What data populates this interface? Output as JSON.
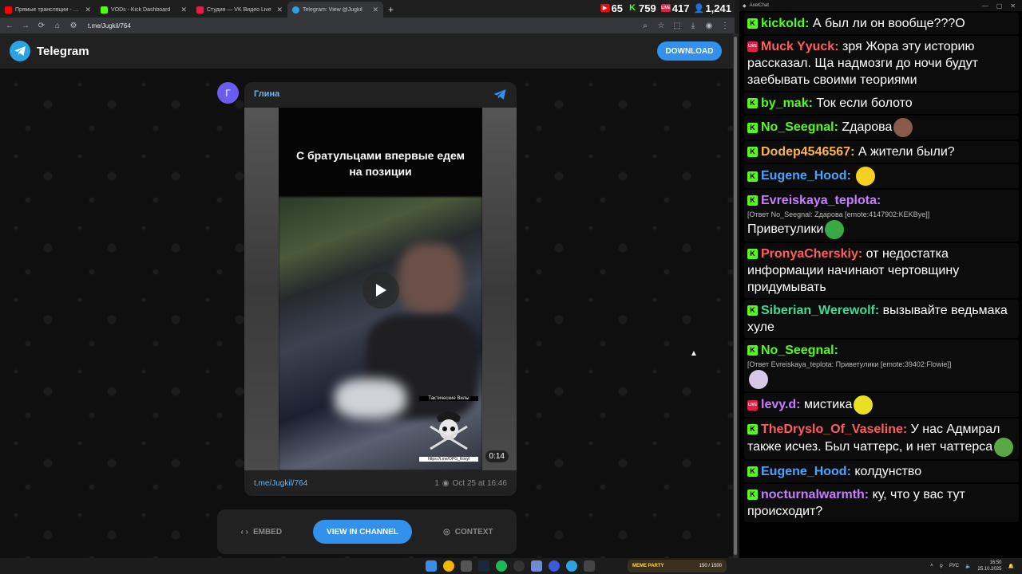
{
  "browser": {
    "tabs": [
      {
        "title": "Прямые трансляции - YouTube",
        "color": "#ff0000",
        "active": false
      },
      {
        "title": "VODs - Kick Dashboard",
        "color": "#53fc18",
        "active": false
      },
      {
        "title": "Студия — VK Видео Live",
        "color": "#e11d48",
        "active": false
      },
      {
        "title": "Telegram: View @Jugkil",
        "color": "#2aa3e0",
        "active": true
      }
    ],
    "new_tab": "+",
    "url": "t.me/Jugkil/764",
    "stats": [
      {
        "platform": "youtube",
        "value": "65",
        "color": "#ff0000"
      },
      {
        "platform": "kick",
        "value": "759",
        "color": "#53fc18"
      },
      {
        "platform": "vk",
        "value": "417",
        "color": "#e11d48"
      },
      {
        "platform": "total",
        "value": "1,241",
        "color": "#4aa3ff"
      }
    ]
  },
  "telegram": {
    "brand": "Telegram",
    "download": "DOWNLOAD",
    "channel_initial": "Г",
    "channel_name": "Глина",
    "video_caption": "С братульцами впервые едем на позиции",
    "watermark_title": "Тактические Вилы",
    "watermark_link": "https://t.me/OPG_Kovyl",
    "duration": "0:14",
    "post_link": "t.me/Jugkil/764",
    "views": "1",
    "date": "Oct 25 at 16:46",
    "actions": {
      "embed": "EMBED",
      "view": "VIEW IN CHANNEL",
      "context": "CONTEXT"
    }
  },
  "chat": {
    "app_title": "AxelChat",
    "messages": [
      {
        "badge": "kick",
        "nick": "kickold:",
        "nick_color": "#53fc18",
        "text": "А был ли он вообще???О"
      },
      {
        "badge": "live",
        "nick": "Muck Yyuck:",
        "nick_color": "#ff5e5e",
        "text": "зря Жора эту историю рассказал. Ща надмозги до ночи будут заебывать своими теориями"
      },
      {
        "badge": "kick",
        "nick": "by_mak:",
        "nick_color": "#53fc18",
        "text": "Ток если болото"
      },
      {
        "badge": "kick",
        "nick": "No_Seegnal:",
        "nick_color": "#53fc18",
        "text": "Zдарова",
        "emote": "#8a5a4a"
      },
      {
        "badge": "kick",
        "nick": "Dodep4546567:",
        "nick_color": "#ffb347",
        "text": "А жители были?"
      },
      {
        "badge": "kick",
        "nick": "Eugene_Hood:",
        "nick_color": "#4aa3ff",
        "text": "",
        "emote": "#f5d020"
      },
      {
        "badge": "kick",
        "nick": "Evreiskaya_teplota:",
        "nick_color": "#c77dff",
        "reply": "[Ответ No_Seegnal: Zдарова [emote:4147902:KEKBye]]",
        "text": "Приветулики",
        "emote": "#3aa845"
      },
      {
        "badge": "kick",
        "nick": "PronyaCherskiy:",
        "nick_color": "#ff5e5e",
        "text": "от недостатка информации начинают чертовщину придумывать"
      },
      {
        "badge": "kick",
        "nick": "Siberian_Werewolf:",
        "nick_color": "#3ddc97",
        "text": "вызывайте ведьмака хуле"
      },
      {
        "badge": "kick",
        "nick": "No_Seegnal:",
        "nick_color": "#53fc18",
        "reply": "[Ответ Evreiskaya_teplota: Приветулики [emote:39402:Flowie]]",
        "text": "",
        "emote": "#d9c7e8"
      },
      {
        "badge": "live",
        "nick": "levy.d:",
        "nick_color": "#c77dff",
        "text": "мистика",
        "emote": "#e8e020"
      },
      {
        "badge": "kick",
        "nick": "TheDryslo_Of_Vaseline:",
        "nick_color": "#ff5e5e",
        "text": "У нас Адмирал также исчез. Был чаттерс, и нет чаттерса",
        "emote": "#5aa845"
      },
      {
        "badge": "kick",
        "nick": "Eugene_Hood:",
        "nick_color": "#4aa3ff",
        "text": "колдунство"
      },
      {
        "badge": "kick",
        "nick": "nocturnalwarmth:",
        "nick_color": "#c77dff",
        "text": "ку, что у вас тут происходит?"
      }
    ]
  },
  "taskbar": {
    "meme_title": "MEME PARTY",
    "meme_count": "150 / 1500",
    "lang": "РУС",
    "time": "16:50",
    "date": "25.10.2025"
  }
}
